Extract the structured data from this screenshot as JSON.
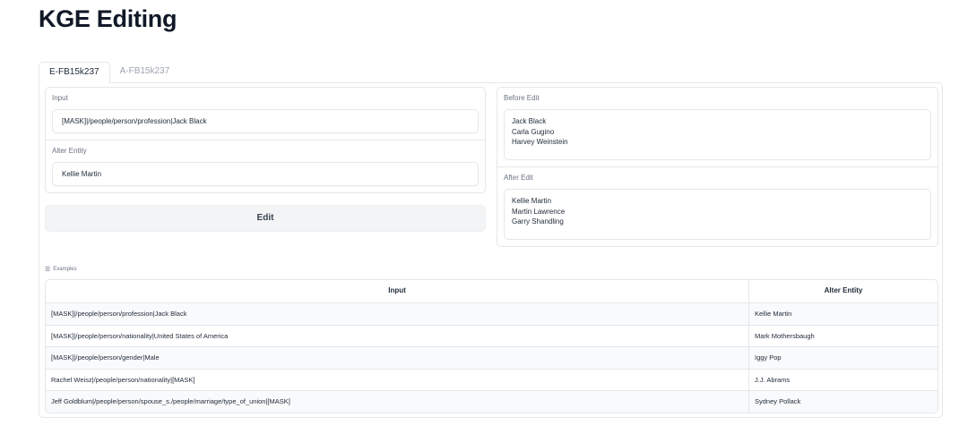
{
  "page": {
    "title": "KGE Editing"
  },
  "tabs": [
    {
      "label": "E-FB15k237",
      "active": true
    },
    {
      "label": "A-FB15k237",
      "active": false
    }
  ],
  "form": {
    "input_label": "Input",
    "input_value": "[MASK]|/people/person/profession|Jack Black",
    "alter_label": "Alter Entity",
    "alter_value": "Kellie Martin",
    "edit_button": "Edit"
  },
  "results": {
    "before_label": "Before Edit",
    "before_lines": [
      "Jack Black",
      "Carla Gugino",
      "Harvey Weinstein"
    ],
    "after_label": "After Edit",
    "after_lines": [
      "Kellie Martin",
      "Martin Lawrence",
      "Garry Shandling"
    ]
  },
  "examples": {
    "label": "Examples",
    "icon": "list-icon",
    "columns": [
      "Input",
      "Alter Entity"
    ],
    "rows": [
      {
        "input": "[MASK]|/people/person/profession|Jack Black",
        "alter": "Kellie Martin"
      },
      {
        "input": "[MASK]|/people/person/nationality|United States of America",
        "alter": "Mark Mothersbaugh"
      },
      {
        "input": "[MASK]|/people/person/gender|Male",
        "alter": "Iggy Pop"
      },
      {
        "input": "Rachel Weisz|/people/person/nationality|[MASK]",
        "alter": "J.J. Abrams"
      },
      {
        "input": "Jeff Goldblum|/people/person/spouse_s./people/marriage/type_of_union|[MASK]",
        "alter": "Sydney Pollack"
      }
    ]
  }
}
